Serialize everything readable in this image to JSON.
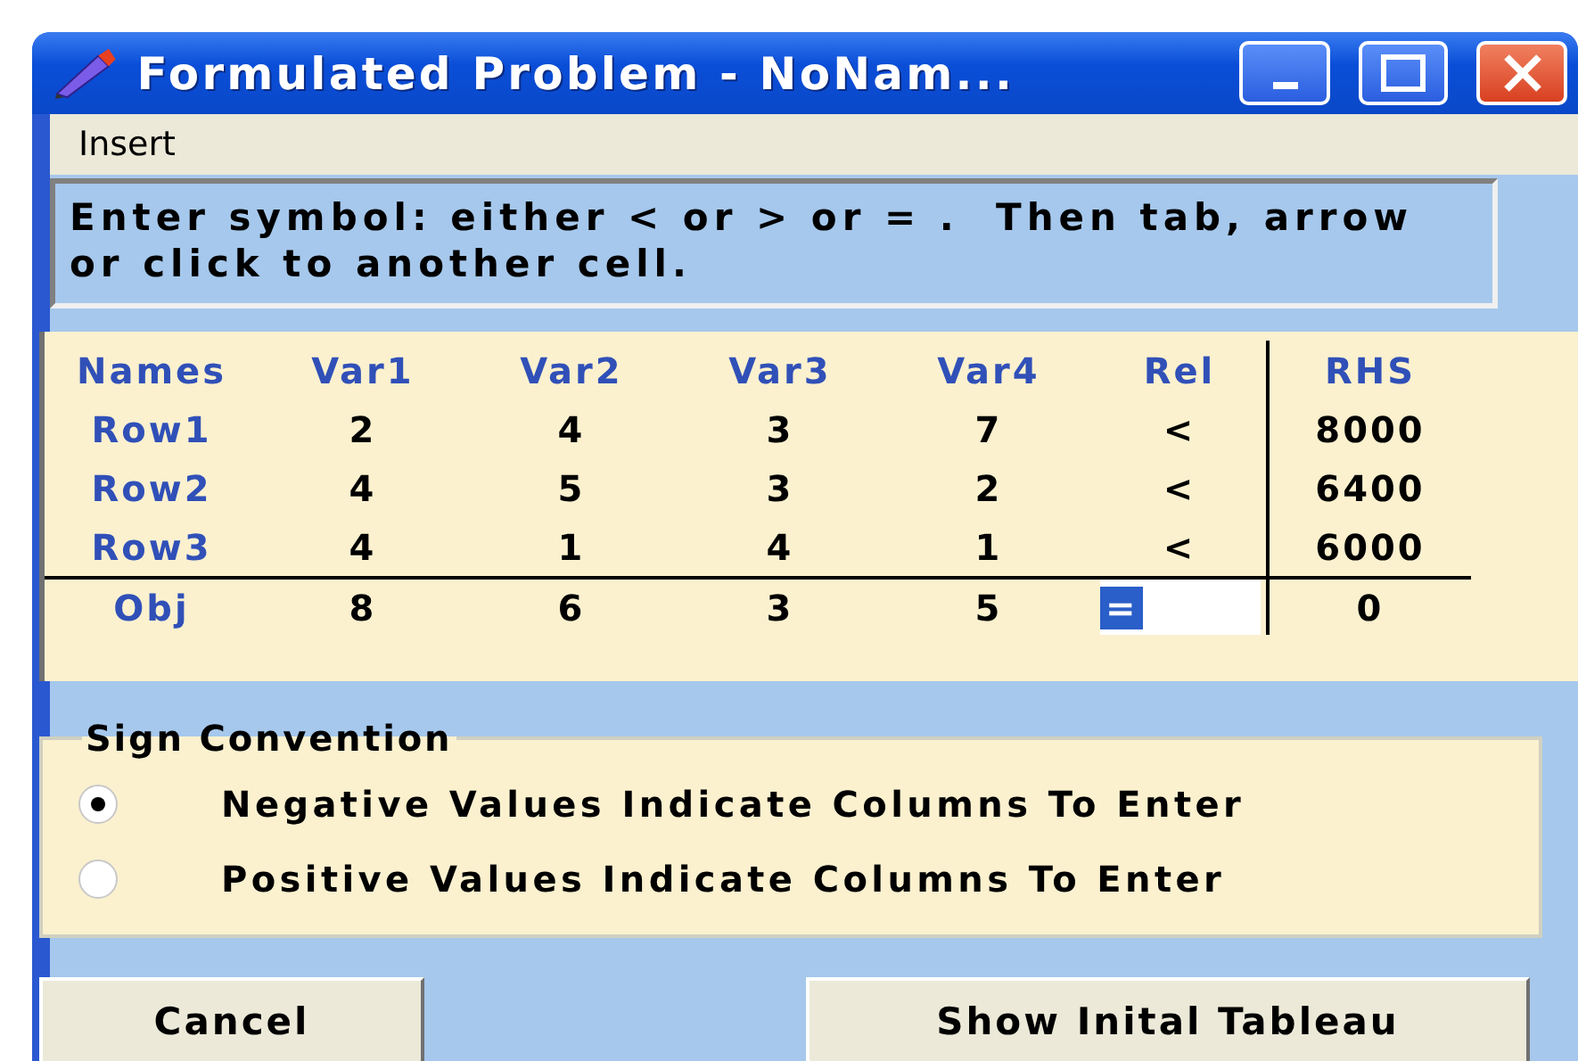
{
  "window": {
    "title": "Formulated Problem - NoNam..."
  },
  "menu": [
    {
      "label": "Insert"
    }
  ],
  "instruction": "Enter symbol: either < or > or = .  Then tab, arrow or click to another cell.",
  "table": {
    "columns": [
      "Names",
      "Var1",
      "Var2",
      "Var3",
      "Var4",
      "Rel",
      "RHS"
    ],
    "rows": [
      {
        "kind": "constraint",
        "rel_editing": false,
        "cells": [
          "Row1",
          "2",
          "4",
          "3",
          "7",
          "<",
          "8000"
        ]
      },
      {
        "kind": "constraint",
        "rel_editing": false,
        "cells": [
          "Row2",
          "4",
          "5",
          "3",
          "2",
          "<",
          "6400"
        ]
      },
      {
        "kind": "constraint",
        "rel_editing": false,
        "cells": [
          "Row3",
          "4",
          "1",
          "4",
          "1",
          "<",
          "6000"
        ]
      },
      {
        "kind": "objective",
        "rel_editing": true,
        "cells": [
          "Obj",
          "8",
          "6",
          "3",
          "5",
          "=",
          "0"
        ]
      }
    ]
  },
  "sign_convention": {
    "title": "Sign Convention",
    "options": [
      {
        "label": "Negative Values Indicate Columns To Enter",
        "selected": true
      },
      {
        "label": "Positive Values Indicate Columns To Enter",
        "selected": false
      }
    ]
  },
  "buttons": [
    {
      "label": "Cancel"
    },
    {
      "label": "Show Inital Tableau"
    }
  ]
}
